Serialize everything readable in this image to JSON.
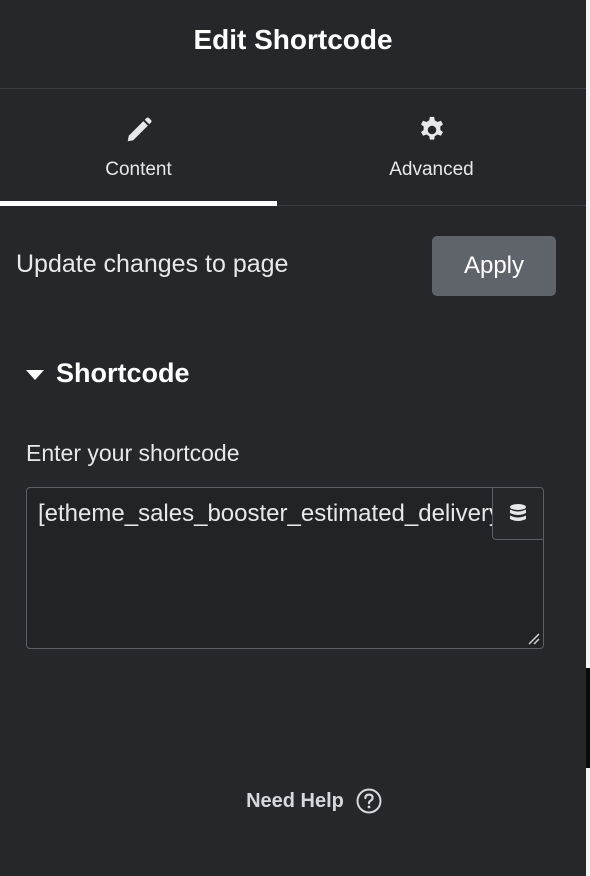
{
  "header": {
    "title": "Edit Shortcode"
  },
  "tabs": [
    {
      "label": "Content",
      "icon": "pencil-icon",
      "active": true
    },
    {
      "label": "Advanced",
      "icon": "gear-icon",
      "active": false
    }
  ],
  "update": {
    "text": "Update changes to page",
    "apply_label": "Apply"
  },
  "section": {
    "title": "Shortcode",
    "expanded": true,
    "field_label": "Enter your shortcode",
    "field_value": "[etheme_sales_booster_estimated_delivery",
    "dynamic_tags_icon": "database-icon"
  },
  "footer": {
    "help_label": "Need Help",
    "help_icon": "question-circle-icon"
  },
  "colors": {
    "panel_bg": "#26272b",
    "apply_bg": "#5f646b",
    "text": "#e6e8ea",
    "active_tab_indicator": "#ffffff"
  }
}
